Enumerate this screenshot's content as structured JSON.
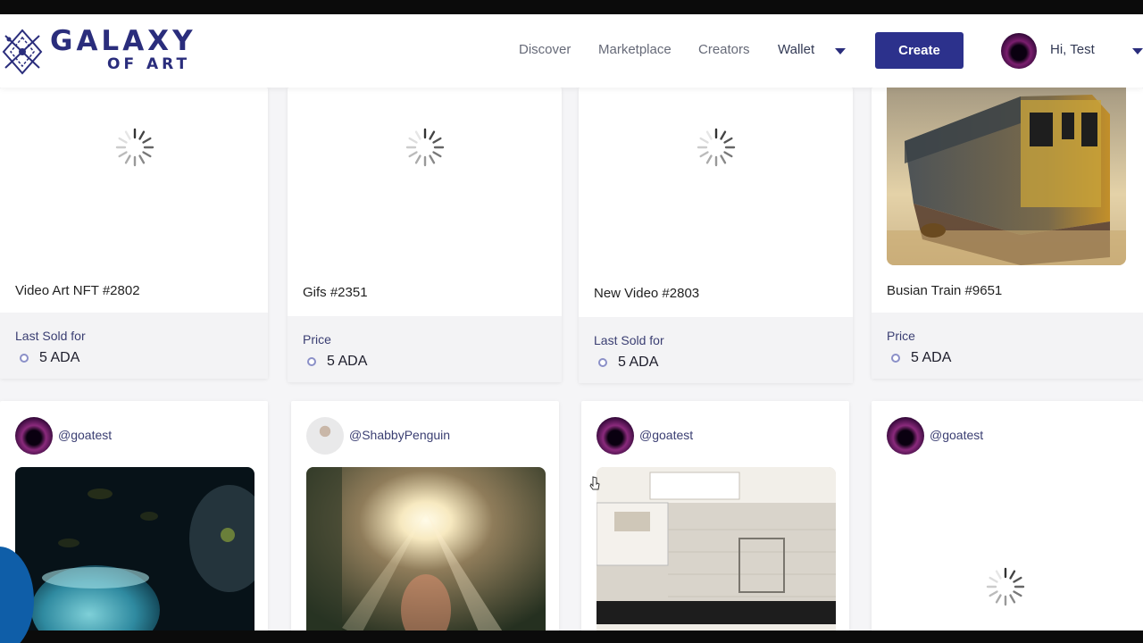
{
  "brand": {
    "line1": "GALAXY",
    "line2": "OF ART"
  },
  "nav": {
    "discover": "Discover",
    "marketplace": "Marketplace",
    "creators": "Creators",
    "wallet": "Wallet"
  },
  "header": {
    "create_label": "Create",
    "greeting": "Hi, Test"
  },
  "cards_top": [
    {
      "title": "Video Art NFT #2802",
      "price_label": "Last Sold for",
      "price": "5 ADA"
    },
    {
      "title": "Gifs #2351",
      "price_label": "Price",
      "price": "5 ADA"
    },
    {
      "title": "New Video #2803",
      "price_label": "Last Sold for",
      "price": "5 ADA"
    },
    {
      "title": "Busian Train #9651",
      "price_label": "Price",
      "price": "5 ADA"
    }
  ],
  "cards_bottom": [
    {
      "owner": "@goatest"
    },
    {
      "owner": "@ShabbyPenguin"
    },
    {
      "owner": "@goatest"
    },
    {
      "owner": "@goatest"
    }
  ],
  "colors": {
    "brand": "#2a2d7c",
    "create_button": "#2c318c",
    "footer_bg": "#f3f3f5"
  },
  "icons": [
    "galaxy-logo-icon",
    "chevron-down-icon",
    "loading-spinner-icon",
    "cardano-coin-icon",
    "avatar-icon",
    "mouse-cursor-icon"
  ]
}
